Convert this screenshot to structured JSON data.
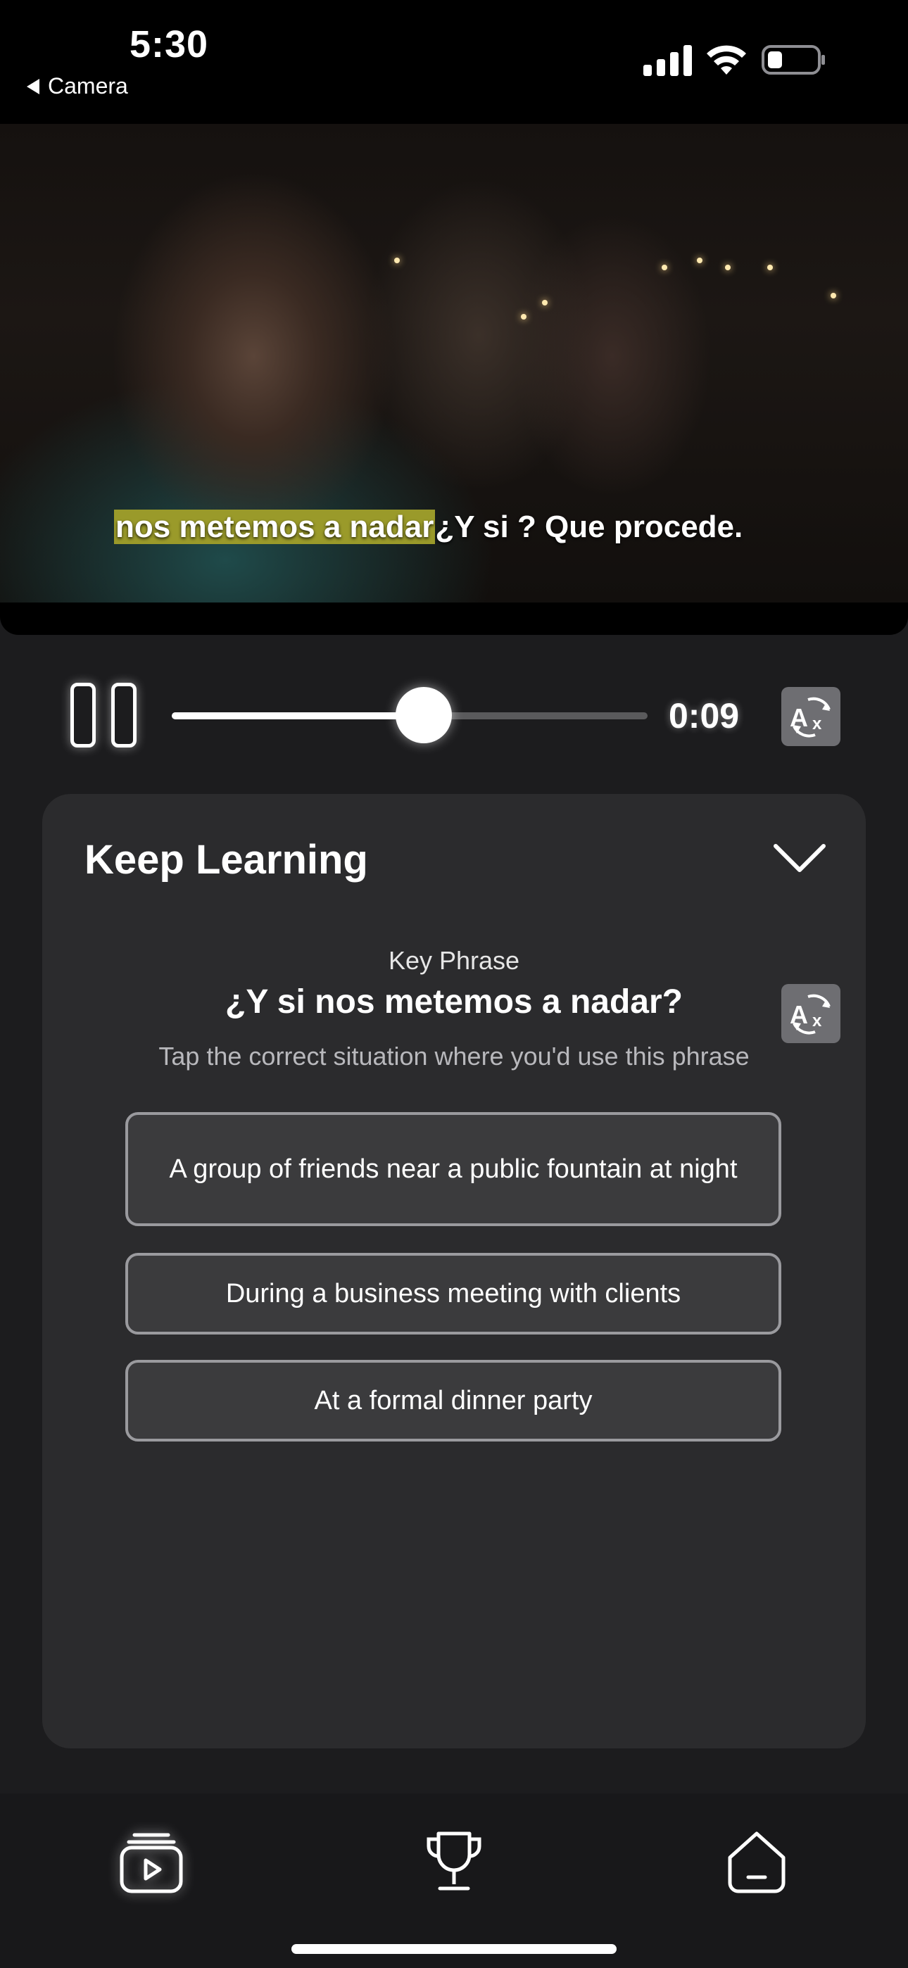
{
  "status_bar": {
    "time": "5:30",
    "back_app": "Camera"
  },
  "video": {
    "subtitle_highlight": "nos metemos a nadar",
    "subtitle_rest": "¿Y si ? Que procede."
  },
  "player": {
    "elapsed": "0:09",
    "progress": 0.53
  },
  "card": {
    "title": "Keep Learning",
    "key_phrase_label": "Key Phrase",
    "key_phrase": "¿Y si nos metemos a nadar?",
    "instruction": "Tap the correct situation where you'd use this phrase",
    "options": [
      "A group of friends near a public fountain at night",
      "During a business meeting with clients",
      "At a formal dinner party"
    ]
  },
  "icons": {
    "pause": "pause-icon",
    "translate": "translate-icon",
    "chevron": "chevron-down-icon",
    "tabs": [
      "videos-icon",
      "trophy-icon",
      "profile-icon"
    ]
  }
}
